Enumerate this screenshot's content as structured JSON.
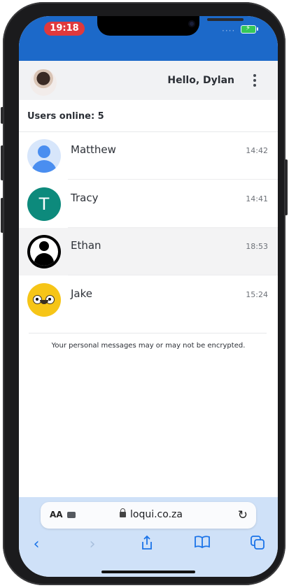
{
  "status": {
    "time": "19:18"
  },
  "header": {
    "greeting": "Hello, Dylan"
  },
  "users_online": "Users online: 5",
  "contacts": [
    {
      "name": "Matthew",
      "time": "14:42",
      "avatar": "default-person-icon"
    },
    {
      "name": "Tracy",
      "time": "14:41",
      "avatar": "letter-avatar",
      "initial": "T"
    },
    {
      "name": "Ethan",
      "time": "18:53",
      "avatar": "person-circle-icon"
    },
    {
      "name": "Jake",
      "time": "15:24",
      "avatar": "jake-dog-icon"
    }
  ],
  "disclaimer": "Your personal messages may or may not be encrypted.",
  "browser": {
    "text_size": "AA",
    "url": "loqui.co.za"
  },
  "colors": {
    "accent": "#1c69c9",
    "toolbar_bg": "#cfe1f8",
    "link": "#1a73e8"
  }
}
